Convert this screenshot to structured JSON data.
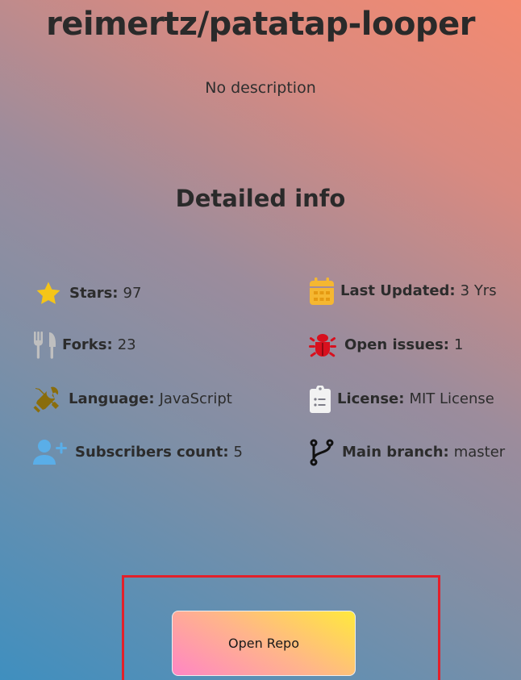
{
  "repo": {
    "title": "reimertz/patatap-looper",
    "description": "No description"
  },
  "details": {
    "heading": "Detailed info",
    "items": [
      {
        "label": "Stars:",
        "value": "97",
        "icon": "star-icon",
        "color": "#f5c518"
      },
      {
        "label": "Forks:",
        "value": "23",
        "icon": "fork-knife-icon",
        "color": "#bfbfbf"
      },
      {
        "label": "Language:",
        "value": "JavaScript",
        "icon": "tools-icon",
        "color": "#8a6d0c"
      },
      {
        "label": "Subscribers count:",
        "value": "5",
        "icon": "user-plus-icon",
        "color": "#5aaee8"
      },
      {
        "label": "Last Updated:",
        "value": "3 Yrs",
        "icon": "calendar-icon",
        "color": "#f5b731"
      },
      {
        "label": "Open issues:",
        "value": "1",
        "icon": "bug-icon",
        "color": "#d8101e"
      },
      {
        "label": "License:",
        "value": "MIT License",
        "icon": "clipboard-list-icon",
        "color": "#f2f2f2"
      },
      {
        "label": "Main branch:",
        "value": "master",
        "icon": "git-branch-icon",
        "color": "#111111"
      }
    ]
  },
  "actions": {
    "open_repo_label": "Open Repo"
  },
  "colors": {
    "highlight_border": "#e3202a"
  }
}
